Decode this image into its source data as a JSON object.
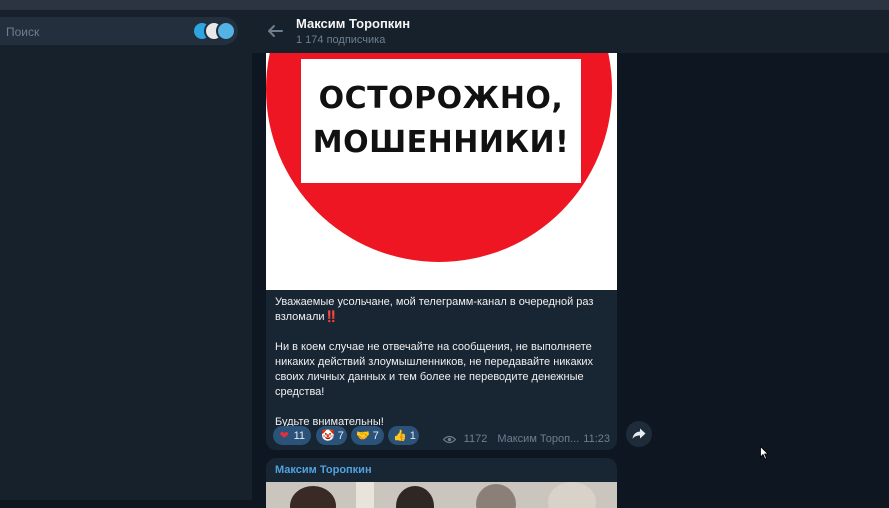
{
  "sidebar": {
    "search": {
      "placeholder": "Поиск"
    },
    "folder_icons": [
      "telegram-icon",
      "group-avatar-icon",
      "channel-avatar-icon"
    ]
  },
  "header": {
    "title": "Максим Торопкин",
    "subscribers": "1 174 подписчика"
  },
  "post": {
    "image_text": [
      "ОСТОРОЖНО,",
      "МОШЕННИКИ!"
    ],
    "text": {
      "p1": "Уважаемые усольчане, мой телеграмм-канал в очередной раз взломали",
      "p1_emoji": "‼️",
      "p2": "Ни в коем случае не отвечайте на сообщения, не выполняете никаких действий злоумышленников, не передавайте никаких своих личных данных и тем более не переводите денежные средства!",
      "p3": "Будьте внимательны!"
    },
    "reactions": [
      {
        "emoji": "❤",
        "count": "11",
        "icon": "heart-icon"
      },
      {
        "emoji": "🤡",
        "count": "7",
        "icon": "clown-icon"
      },
      {
        "emoji": "🤝",
        "count": "7",
        "icon": "handshake-icon"
      },
      {
        "emoji": "👍",
        "count": "1",
        "icon": "thumbs-up-icon"
      }
    ],
    "views": "1172",
    "author": "Максим Тороп...",
    "time": "11:23"
  },
  "next_post": {
    "author": "Максим Торопкин"
  },
  "colors": {
    "background": "#0e1621",
    "sidebar": "#17212b",
    "bubble": "#182533",
    "reaction": "#2b5278",
    "accent": "#4fa3e0",
    "stop_sign_red": "#ee1622"
  }
}
